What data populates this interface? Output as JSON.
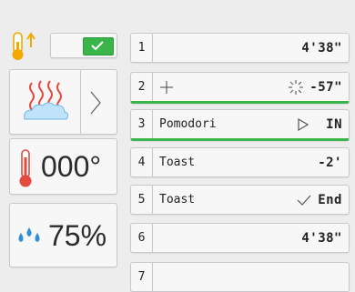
{
  "preheat": {
    "icon": "temperature-up-icon",
    "checked": true
  },
  "steam": {
    "icon": "steam-icon",
    "arrow_icon": "chevron-right-icon"
  },
  "temperature": {
    "icon": "thermometer-icon",
    "value": "000°"
  },
  "humidity": {
    "icon": "water-drops-icon",
    "value": "75%"
  },
  "colors": {
    "accent": "#39b54a",
    "heat": "#e34b3f",
    "water": "#2a8fd6",
    "gold": "#f2a900"
  },
  "programs": [
    {
      "num": "1",
      "name": "",
      "icon": "",
      "status": "4'38\""
    },
    {
      "num": "2",
      "name": "",
      "icon": "plus-icon",
      "status_icon": "sparkle-icon",
      "status": "-57\""
    },
    {
      "num": "3",
      "name": "Pomodori",
      "status_icon": "play-icon",
      "status": "IN"
    },
    {
      "num": "4",
      "name": "Toast",
      "status": "-2'"
    },
    {
      "num": "5",
      "name": "Toast",
      "status_icon": "check-icon",
      "status": "End"
    },
    {
      "num": "6",
      "name": "",
      "status": "4'38\""
    },
    {
      "num": "7",
      "name": "",
      "status": ""
    }
  ]
}
